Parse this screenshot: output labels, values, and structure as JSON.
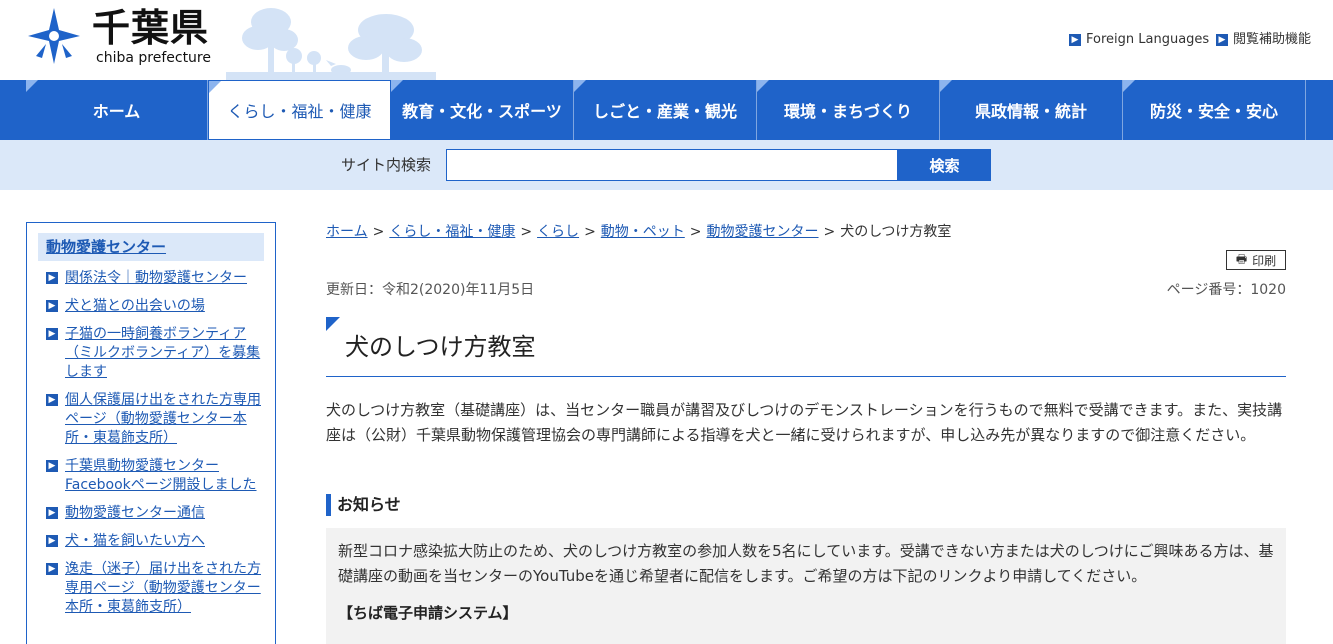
{
  "header": {
    "logo_title": "千葉県",
    "logo_subtitle": "chiba prefecture",
    "foreign_languages": "Foreign Languages",
    "accessibility": "閲覧補助機能"
  },
  "nav": {
    "items": [
      {
        "label": "ホーム"
      },
      {
        "label": "くらし・福祉・健康"
      },
      {
        "label": "教育・文化・スポーツ"
      },
      {
        "label": "しごと・産業・観光"
      },
      {
        "label": "環境・まちづくり"
      },
      {
        "label": "県政情報・統計"
      },
      {
        "label": "防災・安全・安心"
      }
    ],
    "active_index": 1
  },
  "search": {
    "label": "サイト内検索",
    "value": "",
    "button": "検索"
  },
  "sidebar": {
    "heading": "動物愛護センター",
    "items": [
      {
        "label": "関係法令｜動物愛護センター"
      },
      {
        "label": "犬と猫との出会いの場"
      },
      {
        "label": "子猫の一時飼養ボランティア（ミルクボランティア）を募集します"
      },
      {
        "label": "個人保護届け出をされた方専用ページ（動物愛護センター本所・東葛飾支所）"
      },
      {
        "label": "千葉県動物愛護センターFacebookページ開設しました"
      },
      {
        "label": "動物愛護センター通信"
      },
      {
        "label": "犬・猫を飼いたい方へ"
      },
      {
        "label": "逸走（迷子）届け出をされた方専用ページ（動物愛護センター本所・東葛飾支所）"
      }
    ]
  },
  "breadcrumb": {
    "links": [
      {
        "label": "ホーム"
      },
      {
        "label": "くらし・福祉・健康"
      },
      {
        "label": "くらし"
      },
      {
        "label": "動物・ペット"
      },
      {
        "label": "動物愛護センター"
      }
    ],
    "separator": ">",
    "current": "犬のしつけ方教室"
  },
  "page": {
    "print_label": "印刷",
    "updated": "更新日：令和2(2020)年11月5日",
    "page_number": "ページ番号：1020",
    "title": "犬のしつけ方教室",
    "intro": "犬のしつけ方教室（基礎講座）は、当センター職員が講習及びしつけのデモンストレーションを行うもので無料で受講できます。また、実技講座は（公財）千葉県動物保護管理協会の専門講師による指導を犬と一緒に受けられますが、申し込み先が異なりますので御注意ください。",
    "notice_heading": "お知らせ",
    "notice_text": "新型コロナ感染拡大防止のため、犬のしつけ方教室の参加人数を5名にしています。受講できない方または犬のしつけにご興味ある方は、基礎講座の動画を当センターのYouTubeを通じ希望者に配信をします。ご希望の方は下記のリンクより申請してください。",
    "notice_sub": "【ちば電子申請システム】"
  },
  "colors": {
    "brand_blue": "#1f63c9",
    "link_blue": "#1e5ab4",
    "search_bg": "#dbe8f9",
    "notice_bg": "#f2f2f2"
  },
  "icons": {
    "logo": "chiba-logo-icon",
    "bullet": "chevron-right-icon",
    "print": "printer-icon"
  }
}
